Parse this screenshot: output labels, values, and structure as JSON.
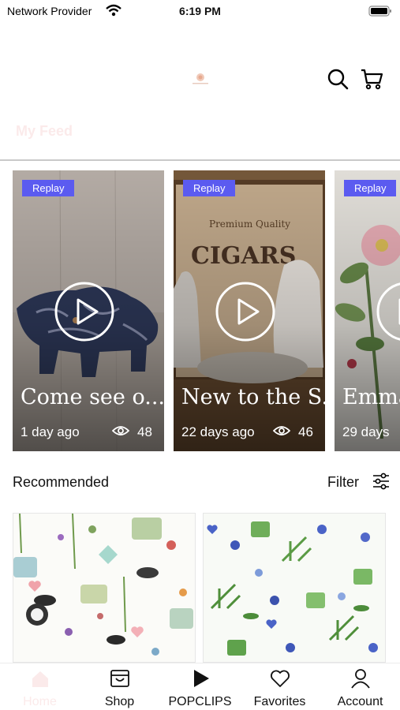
{
  "status_bar": {
    "carrier": "Network Provider",
    "time": "6:19 PM"
  },
  "header": {
    "feed_title": "My Feed",
    "icons": [
      "search-icon",
      "cart-icon"
    ]
  },
  "clips": [
    {
      "badge": "Replay",
      "title": "Come see o...",
      "age": "1 day ago",
      "views": "48"
    },
    {
      "badge": "Replay",
      "title": "New to the S...",
      "age": "22 days ago",
      "views": "46"
    },
    {
      "badge": "Replay",
      "title": "Emma",
      "age": "29 days",
      "views": ""
    }
  ],
  "recommended": {
    "label": "Recommended",
    "filter_label": "Filter"
  },
  "tabs": [
    {
      "label": "Home",
      "icon": "home-icon"
    },
    {
      "label": "Shop",
      "icon": "shop-icon"
    },
    {
      "label": "POPCLIPS",
      "icon": "play-icon"
    },
    {
      "label": "Favorites",
      "icon": "heart-icon"
    },
    {
      "label": "Account",
      "icon": "person-icon"
    }
  ],
  "colors": {
    "replay_badge": "#5b5bf0",
    "divider": "#c9c9c9",
    "faded_text": "#fbeaea"
  }
}
